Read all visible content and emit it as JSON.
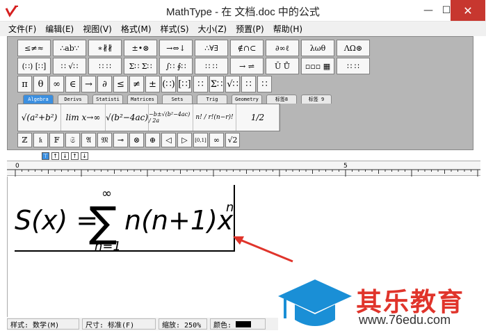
{
  "window": {
    "title": "MathType - 在 文档.doc 中的公式",
    "min_glyph": "—",
    "max_glyph": "☐",
    "close_glyph": "✕"
  },
  "menu": [
    "文件(F)",
    "编辑(E)",
    "视图(V)",
    "格式(M)",
    "样式(S)",
    "大小(Z)",
    "预置(P)",
    "帮助(H)"
  ],
  "toolbar": {
    "row1": [
      "≤≠≈",
      "∴ab∵",
      "∗∦∦",
      "±•⊗",
      "→⇔↓",
      "∴∀∃",
      "∉∩⊂",
      "∂∞ℓ",
      "λωθ",
      "ΛΩ⊛"
    ],
    "row2": [
      "(∷) [∷]",
      "∷ √∷",
      "∷ ∷",
      "Σ∷ Σ∷",
      "∫∷ ∮∷",
      "∷ ∷",
      "→ ⇌",
      "Ū Ů",
      "▫▫▫ ▦",
      "∷ ∷"
    ],
    "row3": [
      "π",
      "θ",
      "∞",
      "∈",
      "→",
      "∂",
      "≤",
      "≠",
      "±",
      "(∷)",
      "[∷]",
      "∷",
      "Σ∷",
      "√∷",
      "∷",
      "∷"
    ],
    "tabs": [
      "Algebra",
      "Derivs",
      "Statisti",
      "Matrices",
      "Sets",
      "Trig",
      "Geometry",
      "标签8",
      "标签 9"
    ],
    "templates": [
      "√(a²+b²)",
      "lim x→∞",
      "√(b²−4ac)",
      "−b±√(b²−4ac) / 2a",
      "n! / r!(n−r)!",
      "1/2"
    ],
    "row5": [
      "ℤ",
      "𝔨",
      "𝔽",
      "𝔖",
      "𝔄",
      "𝔐",
      "⊸",
      "⊗",
      "⊕",
      "◁",
      "▷",
      "[0,1]",
      "∞",
      "√2"
    ]
  },
  "small_icons": [
    "⊤",
    "↑",
    "↓",
    "↑",
    "↓"
  ],
  "ruler": {
    "label0": "0",
    "label5": "5"
  },
  "formula": {
    "lhs": "S(x) =",
    "sum": "∑",
    "upper": "∞",
    "lower": "n=1",
    "body": "n(n+1)x",
    "exp": "n"
  },
  "status": {
    "style": "样式: 数学(M)",
    "size": "尺寸: 标准(F)",
    "zoom": "缩放: 250%",
    "color": "颜色:"
  },
  "watermark": {
    "brand": "其乐教育",
    "url": "www.76edu.com"
  },
  "colors": {
    "arrow": "#e0342b",
    "cap": "#1a8fd6",
    "brand": "#e0342b"
  }
}
